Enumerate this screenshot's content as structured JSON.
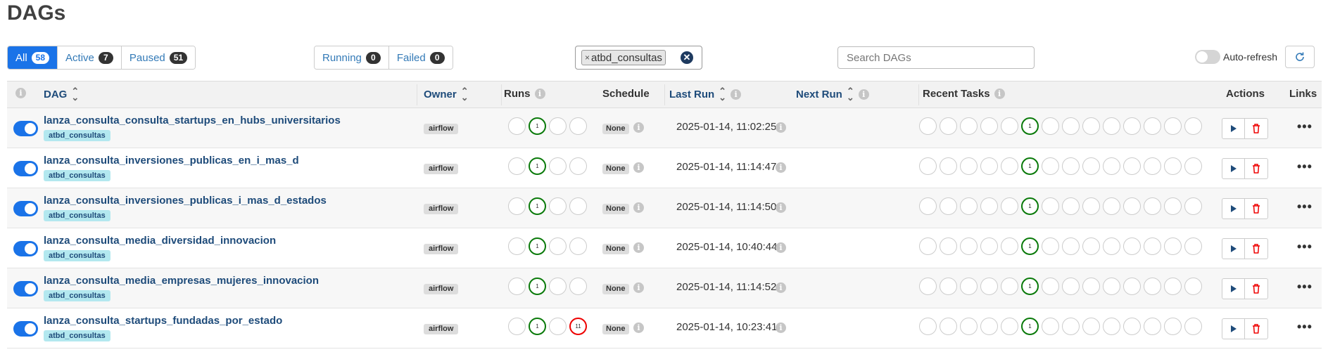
{
  "page_title": "DAGs",
  "status_filters": [
    {
      "label": "All",
      "count": "58",
      "active": true
    },
    {
      "label": "Active",
      "count": "7",
      "active": false
    },
    {
      "label": "Paused",
      "count": "51",
      "active": false
    }
  ],
  "run_filters": [
    {
      "label": "Running",
      "count": "0"
    },
    {
      "label": "Failed",
      "count": "0"
    }
  ],
  "tag_filter": {
    "selected_tag": "atbd_consultas",
    "remove_glyph": "×",
    "clear_glyph": "✕"
  },
  "search": {
    "placeholder": "Search DAGs",
    "value": ""
  },
  "auto_refresh": {
    "label": "Auto-refresh",
    "enabled": false
  },
  "table": {
    "headers": {
      "dag": "DAG",
      "owner": "Owner",
      "runs": "Runs",
      "schedule": "Schedule",
      "last_run": "Last Run",
      "next_run": "Next Run",
      "recent_tasks": "Recent Tasks",
      "actions": "Actions",
      "links": "Links"
    },
    "rows": [
      {
        "dag_id": "lanza_consulta_consulta_startups_en_hubs_universitarios",
        "tag": "atbd_consultas",
        "owner": "airflow",
        "runs": [
          "",
          "1",
          "",
          ""
        ],
        "runs_state": [
          "none",
          "success",
          "none",
          "none"
        ],
        "schedule": "None",
        "last_run": "2025-01-14, 11:02:25",
        "enabled": true
      },
      {
        "dag_id": "lanza_consulta_inversiones_publicas_en_i_mas_d",
        "tag": "atbd_consultas",
        "owner": "airflow",
        "runs": [
          "",
          "1",
          "",
          ""
        ],
        "runs_state": [
          "none",
          "success",
          "none",
          "none"
        ],
        "schedule": "None",
        "last_run": "2025-01-14, 11:14:47",
        "enabled": true
      },
      {
        "dag_id": "lanza_consulta_inversiones_publicas_i_mas_d_estados",
        "tag": "atbd_consultas",
        "owner": "airflow",
        "runs": [
          "",
          "1",
          "",
          ""
        ],
        "runs_state": [
          "none",
          "success",
          "none",
          "none"
        ],
        "schedule": "None",
        "last_run": "2025-01-14, 11:14:50",
        "enabled": true
      },
      {
        "dag_id": "lanza_consulta_media_diversidad_innovacion",
        "tag": "atbd_consultas",
        "owner": "airflow",
        "runs": [
          "",
          "1",
          "",
          ""
        ],
        "runs_state": [
          "none",
          "success",
          "none",
          "none"
        ],
        "schedule": "None",
        "last_run": "2025-01-14, 10:40:44",
        "enabled": true
      },
      {
        "dag_id": "lanza_consulta_media_empresas_mujeres_innovacion",
        "tag": "atbd_consultas",
        "owner": "airflow",
        "runs": [
          "",
          "1",
          "",
          ""
        ],
        "runs_state": [
          "none",
          "success",
          "none",
          "none"
        ],
        "schedule": "None",
        "last_run": "2025-01-14, 11:14:52",
        "enabled": true
      },
      {
        "dag_id": "lanza_consulta_startups_fundadas_por_estado",
        "tag": "atbd_consultas",
        "owner": "airflow",
        "runs": [
          "",
          "1",
          "",
          "11"
        ],
        "runs_state": [
          "none",
          "success",
          "none",
          "failed"
        ],
        "schedule": "None",
        "last_run": "2025-01-14, 10:23:41",
        "enabled": true
      }
    ],
    "recent_tasks_success_count": "1",
    "more_glyph": "•••"
  },
  "colors": {
    "accent": "#1a73e8",
    "link": "#1e4b7a",
    "success": "#0a7a0a",
    "failed": "#e00000",
    "tag_bg": "#b3e8ef"
  }
}
